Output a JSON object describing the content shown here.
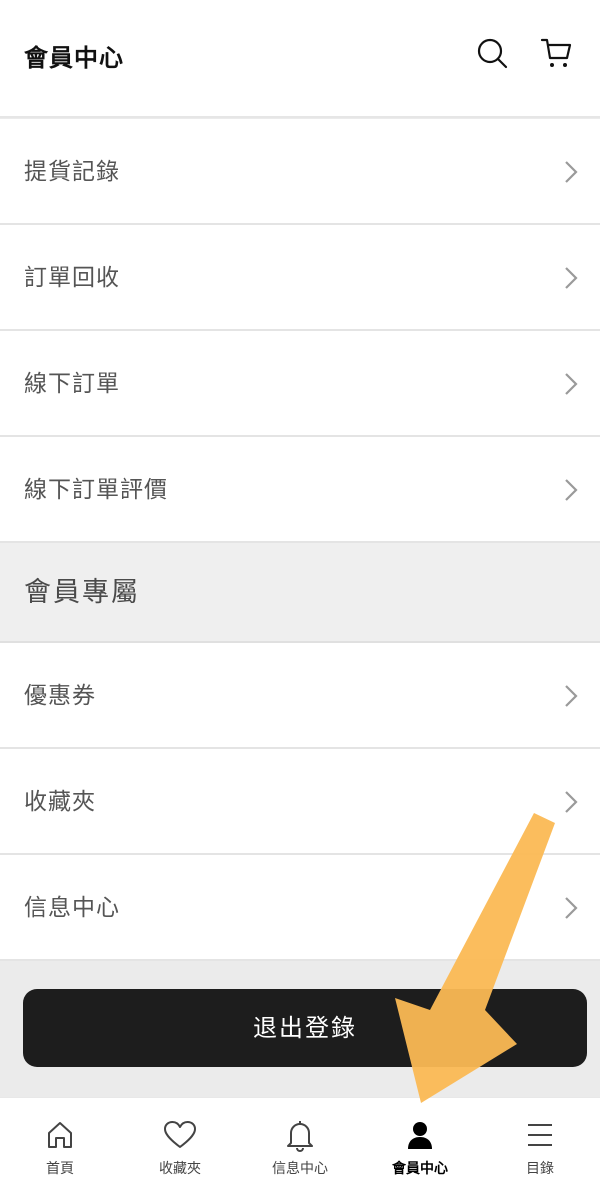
{
  "header": {
    "title": "會員中心",
    "icons": [
      "search-icon",
      "cart-icon"
    ]
  },
  "menu_items": [
    {
      "label": "提貨記錄"
    },
    {
      "label": "訂單回收"
    },
    {
      "label": "線下訂單"
    },
    {
      "label": "線下訂單評價"
    }
  ],
  "section": {
    "title": "會員專屬"
  },
  "member_items": [
    {
      "label": "優惠券"
    },
    {
      "label": "收藏夾"
    },
    {
      "label": "信息中心"
    }
  ],
  "logout_label": "退出登錄",
  "tabbar": {
    "items": [
      {
        "label": "首頁",
        "icon": "home-icon"
      },
      {
        "label": "收藏夾",
        "icon": "heart-icon"
      },
      {
        "label": "信息中心",
        "icon": "bell-icon"
      },
      {
        "label": "會員中心",
        "icon": "user-icon",
        "active": true
      },
      {
        "label": "目錄",
        "icon": "menu-icon"
      }
    ]
  },
  "colors": {
    "annotation_arrow": "#fbb954",
    "logout_bg": "#1d1d1d"
  }
}
